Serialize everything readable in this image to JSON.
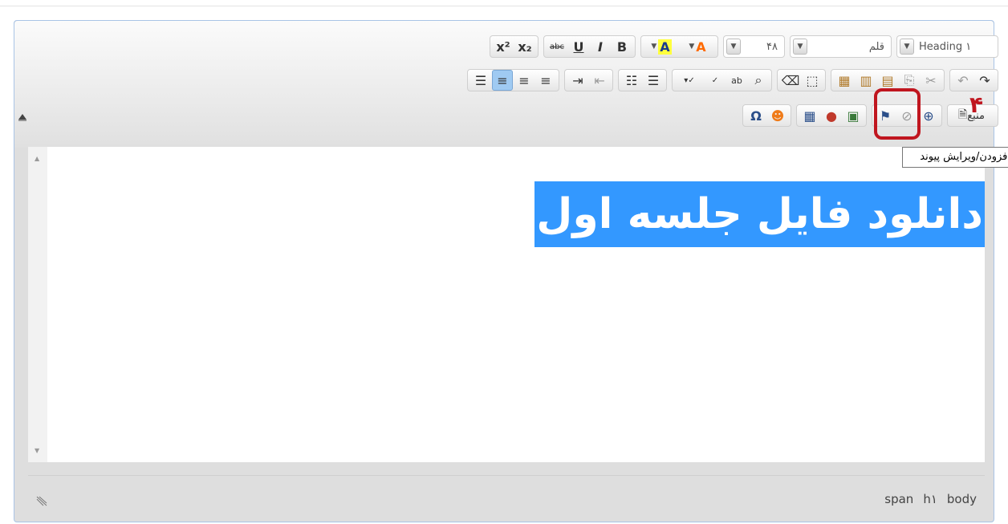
{
  "toolbar": {
    "row1": {
      "format_combo": "Heading ۱",
      "font_combo": "قلم",
      "size_combo": "۴۸",
      "bold": "B",
      "italic": "I",
      "underline": "U",
      "strike": "abc",
      "subscript": "x₂",
      "superscript": "x²",
      "font_color": "A",
      "bg_color": "A"
    },
    "row3": {
      "source_label": "منبع"
    }
  },
  "annotation": {
    "step_number": "۴",
    "tooltip": "افزودن/ویرایش پیوند"
  },
  "editor": {
    "content_text": "دانلود فایل جلسه اول"
  },
  "statusbar": {
    "path": [
      "body",
      "h۱",
      "span"
    ]
  },
  "colors": {
    "highlight": "#c0161f",
    "selection": "#3398ff"
  }
}
